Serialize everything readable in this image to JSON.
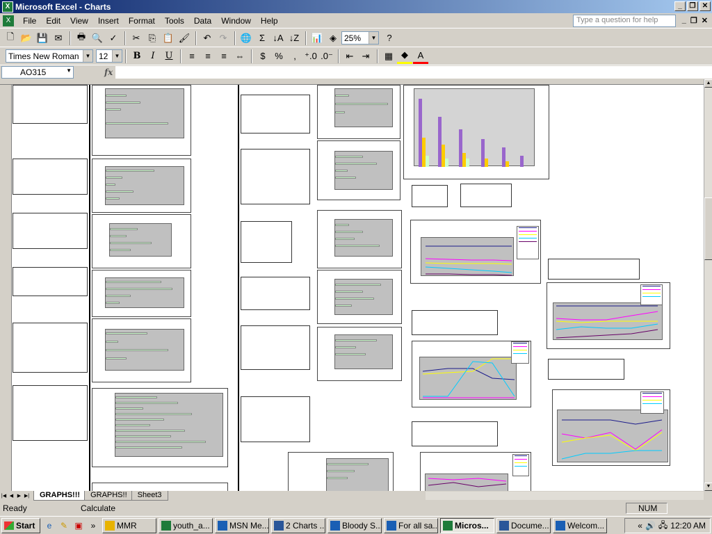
{
  "window": {
    "title": "Microsoft Excel - Charts"
  },
  "menu": [
    "File",
    "Edit",
    "View",
    "Insert",
    "Format",
    "Tools",
    "Data",
    "Window",
    "Help"
  ],
  "help_placeholder": "Type a question for help",
  "toolbar": {
    "zoom": "25%",
    "font": "Times New Roman",
    "size": "12"
  },
  "formula_bar": {
    "cell": "AO315",
    "fx": "fx"
  },
  "sheet_tabs": [
    "GRAPHS!!!",
    "GRAPHS!!",
    "Sheet3"
  ],
  "status": {
    "ready": "Ready",
    "calc": "Calculate",
    "num": "NUM"
  },
  "taskbar": {
    "start": "Start",
    "tasks": [
      {
        "label": "MMR",
        "icon": "folder-icon",
        "color": "#e8b300"
      },
      {
        "label": "youth_a...",
        "icon": "excel-icon",
        "color": "#1e7b3a"
      },
      {
        "label": "MSN Me...",
        "icon": "msn-icon",
        "color": "#1a5fb4"
      },
      {
        "label": "2 Charts ...",
        "icon": "word-icon",
        "color": "#2a5699"
      },
      {
        "label": "Bloody S...",
        "icon": "ie-icon",
        "color": "#1a5fb4"
      },
      {
        "label": "For all sa...",
        "icon": "ie-icon",
        "color": "#1a5fb4"
      },
      {
        "label": "Micros...",
        "icon": "excel-icon",
        "color": "#1e7b3a"
      },
      {
        "label": "Docume...",
        "icon": "word-icon",
        "color": "#2a5699"
      },
      {
        "label": "Welcom...",
        "icon": "ie-icon",
        "color": "#1a5fb4"
      }
    ],
    "clock": "12:20 AM"
  }
}
